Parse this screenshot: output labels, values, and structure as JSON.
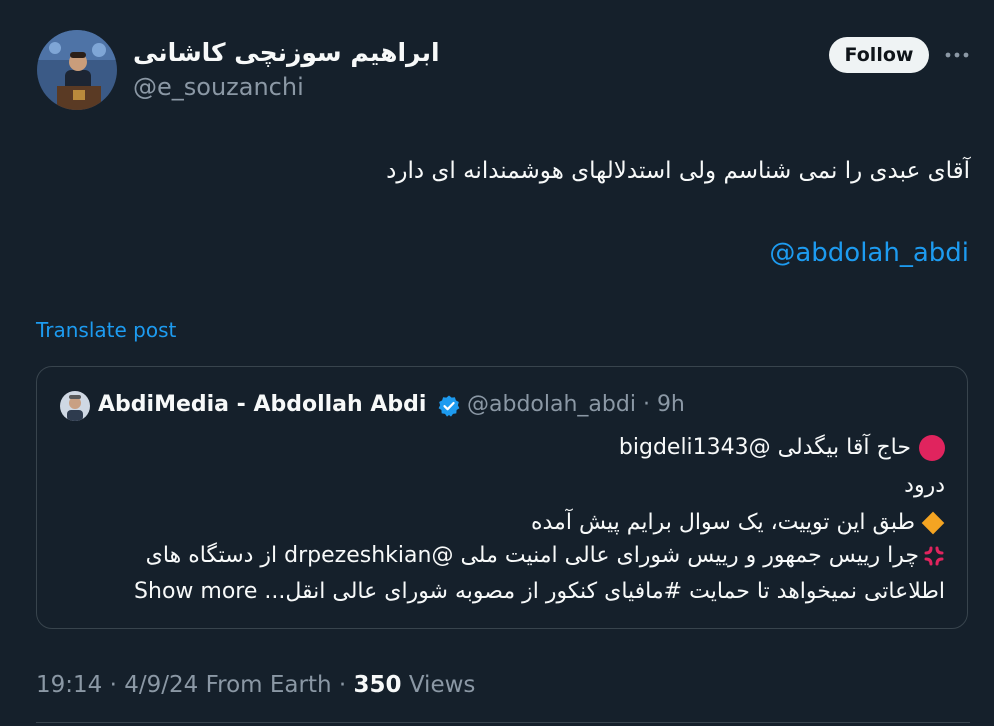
{
  "author": {
    "display_name": "ابراهیم سوزنچی کاشانی",
    "handle": "@e_souzanchi"
  },
  "follow_label": "Follow",
  "more_icon": "more-horizontal-icon",
  "tweet": {
    "text": "آقای عبدی را نمی شناسم ولی استدلالهای هوشمندانه ای دارد",
    "mention": "@abdolah_abdi",
    "translate_label": "Translate post"
  },
  "quoted": {
    "display_name": "AbdiMedia - Abdollah Abdi",
    "verified_icon": "verified-badge-icon",
    "handle": "@abdolah_abdi",
    "separator": "·",
    "time": "9h",
    "lines": [
      "حاج آقا بیگدلی @bigdeli1343",
      "درود",
      "طبق این توییت، یک سوال برایم پیش آمده",
      "چرا رییس جمهور و رییس شورای عالی امنیت ملی @drpezeshkian  از دستگاه های",
      "اطلاعاتی نمیخواهد تا حمایت #مافیای کنکور از مصوبه شورای عالی انقل..."
    ],
    "show_more": "Show more"
  },
  "footer": {
    "time": "19:14",
    "separator": "·",
    "date": "4/9/24",
    "source": "From Earth",
    "views_count": "350",
    "views_label": "Views"
  },
  "colors": {
    "background": "#15202b",
    "accent": "#1d9bf0",
    "text": "#f7f9f9",
    "muted": "#8b98a5",
    "border": "#38444d"
  }
}
